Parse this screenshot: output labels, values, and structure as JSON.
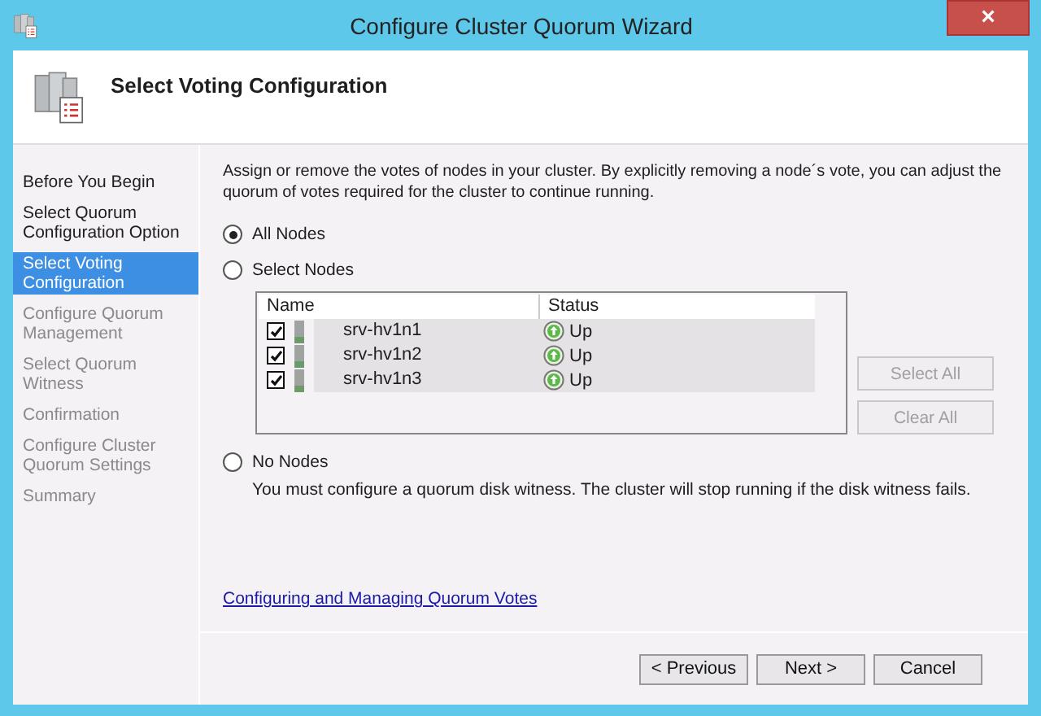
{
  "window": {
    "title": "Configure Cluster Quorum Wizard",
    "close": "×"
  },
  "header": {
    "title": "Select Voting Configuration"
  },
  "steps": [
    {
      "label": "Before You Begin",
      "selected": false,
      "disabled": false
    },
    {
      "label": "Select Quorum Configuration Option",
      "selected": false,
      "disabled": false
    },
    {
      "label": "Select Voting Configuration",
      "selected": true,
      "disabled": false
    },
    {
      "label": "Configure Quorum Management",
      "selected": false,
      "disabled": true
    },
    {
      "label": "Select Quorum Witness",
      "selected": false,
      "disabled": true
    },
    {
      "label": "Confirmation",
      "selected": false,
      "disabled": true
    },
    {
      "label": "Configure Cluster Quorum Settings",
      "selected": false,
      "disabled": true
    },
    {
      "label": "Summary",
      "selected": false,
      "disabled": true
    }
  ],
  "intro": "Assign or remove the votes of nodes in your cluster. By explicitly removing a node´s vote, you can adjust the quorum of votes required for the cluster to continue running.",
  "options": [
    {
      "label": "All Nodes",
      "selected": true
    },
    {
      "label": "Select Nodes",
      "selected": false
    },
    {
      "label": "No Nodes",
      "selected": false,
      "note": "You must configure a quorum disk witness. The cluster will stop running if the disk witness fails."
    }
  ],
  "nodes": {
    "columns": [
      "Name",
      "Status"
    ],
    "rows": [
      {
        "name": "srv-hv1n1",
        "status": "Up",
        "checked": true
      },
      {
        "name": "srv-hv1n2",
        "status": "Up",
        "checked": true
      },
      {
        "name": "srv-hv1n3",
        "status": "Up",
        "checked": true
      }
    ],
    "buttons": [
      {
        "label": "Select All",
        "disabled": true
      },
      {
        "label": "Clear All",
        "disabled": true
      }
    ]
  },
  "link": "Configuring and Managing Quorum Votes",
  "buttons": [
    {
      "label": "< Previous",
      "disabled": false
    },
    {
      "label": "Next >",
      "disabled": false
    },
    {
      "label": "Cancel",
      "disabled": false
    }
  ]
}
